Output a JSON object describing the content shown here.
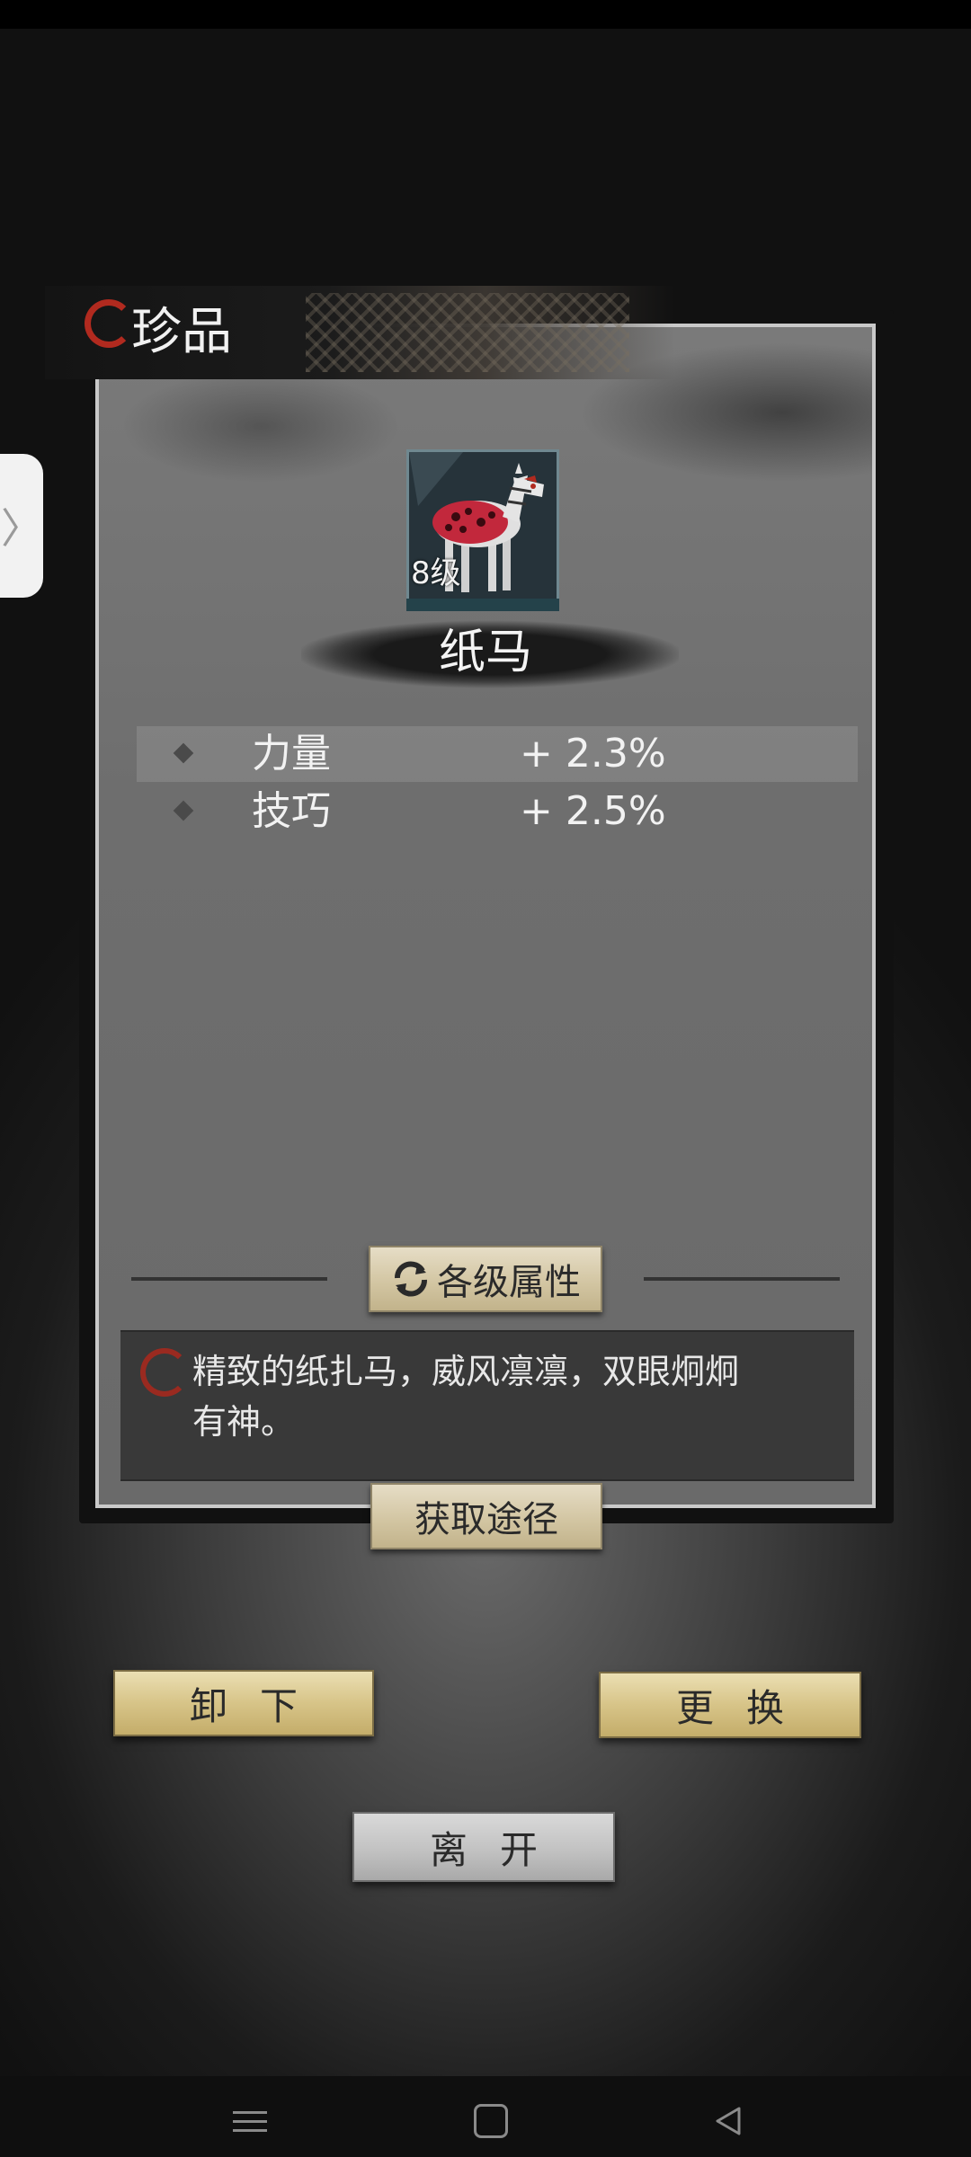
{
  "panel": {
    "title": "珍品"
  },
  "item": {
    "level": "8级",
    "name": "纸马",
    "icon": "paper-horse-icon"
  },
  "stats": [
    {
      "name": "力量",
      "value": "+ 2.3%"
    },
    {
      "name": "技巧",
      "value": "+ 2.5%"
    }
  ],
  "buttons": {
    "level_attrs": "各级属性",
    "obtain": "获取途径",
    "unequip": "卸下",
    "replace": "更换",
    "leave": "离开"
  },
  "description": {
    "line1": "精致的纸扎马，威风凛凛，双眼炯炯",
    "line2": "有神。"
  },
  "side_tab": {
    "glyph": "〉"
  },
  "colors": {
    "seal_red": "#b12a1f",
    "gold_button": "#d7c488",
    "silver_button": "#c2c2c2"
  }
}
